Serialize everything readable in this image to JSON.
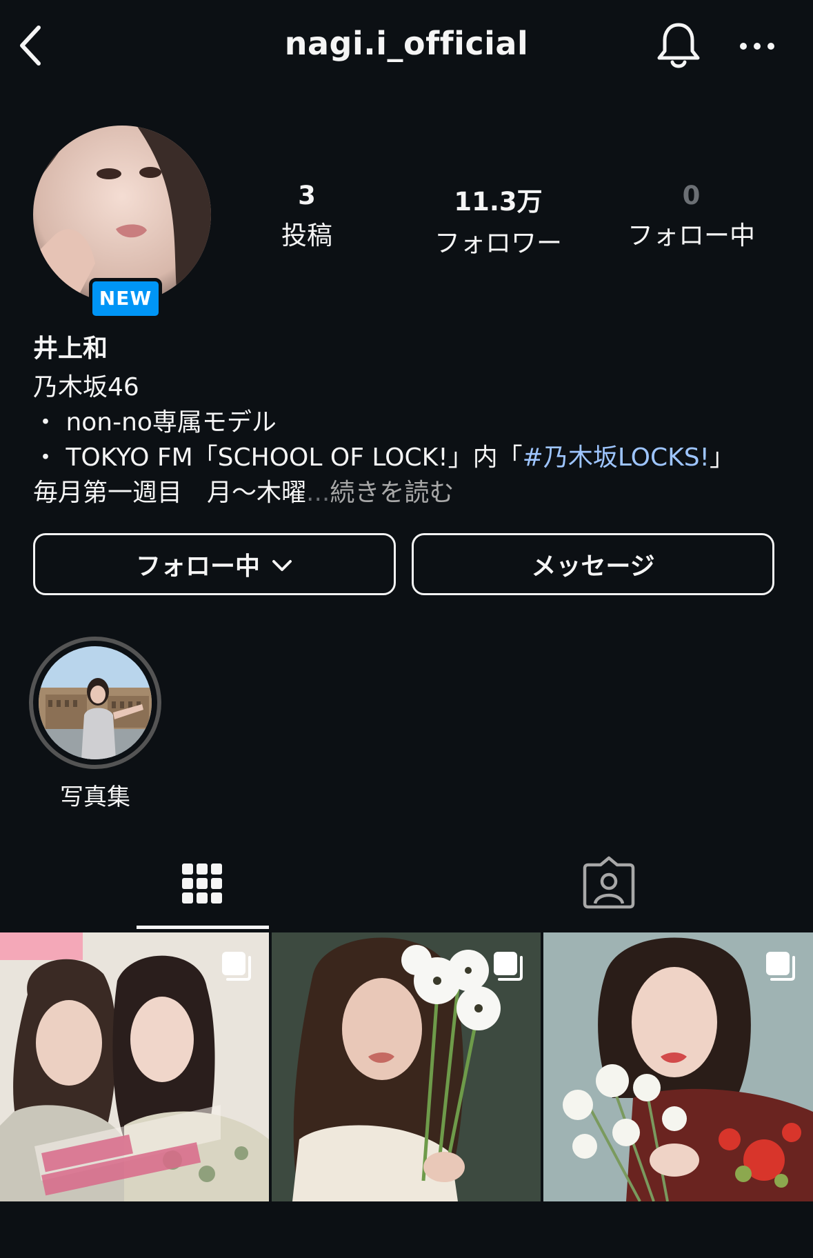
{
  "header": {
    "username": "nagi.i_official",
    "icons": [
      "back-icon",
      "bell-icon",
      "more-icon"
    ]
  },
  "profile": {
    "badge": "NEW",
    "stats": {
      "posts": {
        "value": "3",
        "label": "投稿"
      },
      "followers": {
        "value": "11.3万",
        "label": "フォロワー"
      },
      "following": {
        "value": "0",
        "label": "フォロー中"
      }
    },
    "name": "井上和",
    "bio": {
      "line1": "乃木坂46",
      "line2": "・ non-no専属モデル",
      "line3_prefix": "・ TOKYO FM「SCHOOL OF LOCK!」内「",
      "line3_hashtag": "#乃木坂LOCKS!",
      "line3_suffix": "」",
      "line4": "毎月第一週目　月〜木曜",
      "line4_ellipsis": "...",
      "read_more": "続きを読む"
    }
  },
  "actions": {
    "follow_label": "フォロー中",
    "message_label": "メッセージ"
  },
  "highlights": [
    {
      "label": "写真集"
    }
  ],
  "tabs": {
    "active": "grid",
    "items": [
      "grid-icon",
      "tagged-icon"
    ]
  },
  "posts": [
    {
      "type": "carousel",
      "subject": "magazine-cover"
    },
    {
      "type": "carousel",
      "subject": "flowers-portrait"
    },
    {
      "type": "carousel",
      "subject": "kimono-portrait"
    }
  ],
  "colors": {
    "background": "#0c1014",
    "text": "#f5f5f5",
    "badge": "#0095f6",
    "hashtag": "#9ec5ff",
    "muted": "#a8a8a8"
  }
}
